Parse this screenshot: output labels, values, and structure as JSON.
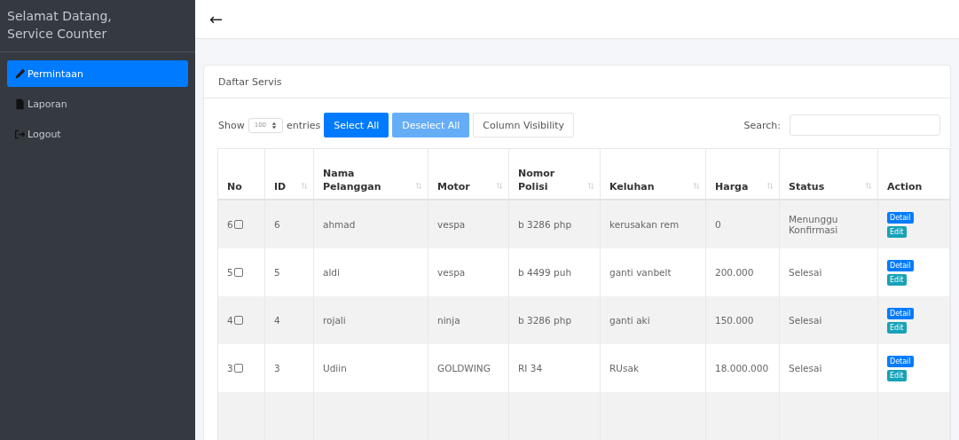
{
  "sidebar": {
    "greeting": [
      "Selamat Datang,",
      "Service Counter"
    ],
    "items": [
      {
        "label": "Permintaan",
        "selected": true
      },
      {
        "label": "Laporan",
        "selected": false
      },
      {
        "label": "Logout",
        "selected": false
      }
    ]
  },
  "header": {
    "back": "←"
  },
  "card": {
    "title": "Daftar Servis",
    "length": {
      "before": "Show",
      "value": "100",
      "after": "entries"
    },
    "buttons": [
      {
        "label": "Select All",
        "kind": "primary"
      },
      {
        "label": "Deselect All",
        "kind": "faded"
      },
      {
        "label": "Column Visibility",
        "kind": "plain"
      }
    ],
    "search": {
      "label": "Search:"
    },
    "table": {
      "columns": [
        {
          "label": "No",
          "sortable": false
        },
        {
          "label": "ID",
          "sortable": true
        },
        {
          "label": "Nama Pelanggan",
          "sortable": true
        },
        {
          "label": "Motor",
          "sortable": true
        },
        {
          "label": "Nomor Polisi",
          "sortable": true
        },
        {
          "label": "Keluhan",
          "sortable": true
        },
        {
          "label": "Harga",
          "sortable": true
        },
        {
          "label": "Status",
          "sortable": true
        },
        {
          "label": "Action",
          "sortable": false
        }
      ],
      "rows": [
        {
          "checked": false,
          "cells": [
            "6",
            "6",
            "ahmad",
            "vespa",
            "b 3286 php",
            "kerusakan rem",
            "0",
            "Menunggu Konfirmasi"
          ],
          "actions": [
            "Detail",
            "Edit"
          ]
        },
        {
          "checked": false,
          "cells": [
            "5",
            "5",
            "aldi",
            "vespa",
            "b 4499 puh",
            "ganti vanbelt",
            "200.000",
            "Selesai"
          ],
          "actions": [
            "Detail",
            "Edit"
          ]
        },
        {
          "checked": false,
          "cells": [
            "4",
            "4",
            "rojali",
            "ninja",
            "b 3286 php",
            "ganti aki",
            "150.000",
            "Selesai"
          ],
          "actions": [
            "Detail",
            "Edit"
          ]
        },
        {
          "checked": false,
          "cells": [
            "3",
            "3",
            "Udiin",
            "GOLDWING",
            "RI 34",
            "RUsak",
            "18.000.000",
            "Selesai"
          ],
          "actions": [
            "Detail",
            "Edit"
          ]
        }
      ]
    }
  }
}
